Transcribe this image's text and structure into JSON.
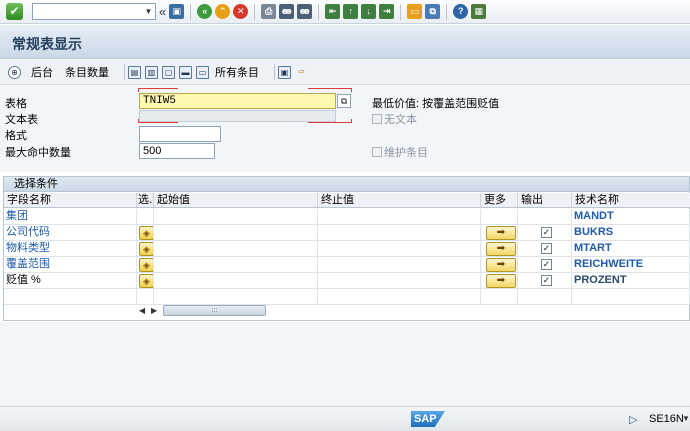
{
  "system_toolbar": {
    "command_field_value": "",
    "icons": [
      "ok-icon",
      "back-arrows-icon",
      "save-icon",
      "back-icon",
      "exit-icon",
      "cancel-icon",
      "print-icon",
      "find-icon",
      "find-next-icon",
      "first-page-icon",
      "prev-page-icon",
      "next-page-icon",
      "last-page-icon",
      "new-session-icon",
      "shortcut-icon",
      "help-icon",
      "customize-icon"
    ]
  },
  "title": "常规表显示",
  "app_toolbar": {
    "background_label": "后台",
    "entries_count_label": "条目数量",
    "all_entries_label": "所有条目"
  },
  "form": {
    "table_label": "表格",
    "table_value": "TNIW5",
    "text_table_label": "文本表",
    "text_table_value": "",
    "format_label": "格式",
    "format_value": "",
    "max_hits_label": "最大命中数量",
    "max_hits_value": "500",
    "min_value_label": "最低价值: 按覆盖范围贬值",
    "no_text_label": "无文本",
    "maintain_entries_label": "维护条目"
  },
  "selection": {
    "title": "选择条件",
    "columns": {
      "field_name": "字段名称",
      "sel": "选.",
      "from": "起始值",
      "to": "终止值",
      "more": "更多",
      "output": "输出",
      "tech_name": "技术名称"
    },
    "rows": [
      {
        "field": "集团",
        "tech": "MANDT",
        "has_sel": false,
        "output": false,
        "link": true
      },
      {
        "field": "公司代码",
        "tech": "BUKRS",
        "has_sel": true,
        "output": true,
        "link": true
      },
      {
        "field": "物料类型",
        "tech": "MTART",
        "has_sel": true,
        "output": true,
        "link": true
      },
      {
        "field": "覆盖范围",
        "tech": "REICHWEITE",
        "has_sel": true,
        "output": true,
        "link": true
      },
      {
        "field": "贬值 %",
        "tech": "PROZENT",
        "has_sel": true,
        "output": true,
        "link": false
      }
    ]
  },
  "status_bar": {
    "logo": "SAP",
    "tcode": "SE16N"
  },
  "colors": {
    "accent": "#1e5aa8",
    "title": "#243f5e",
    "highlight_input": "#fff8b0",
    "marker_red": "#e03a3a"
  }
}
